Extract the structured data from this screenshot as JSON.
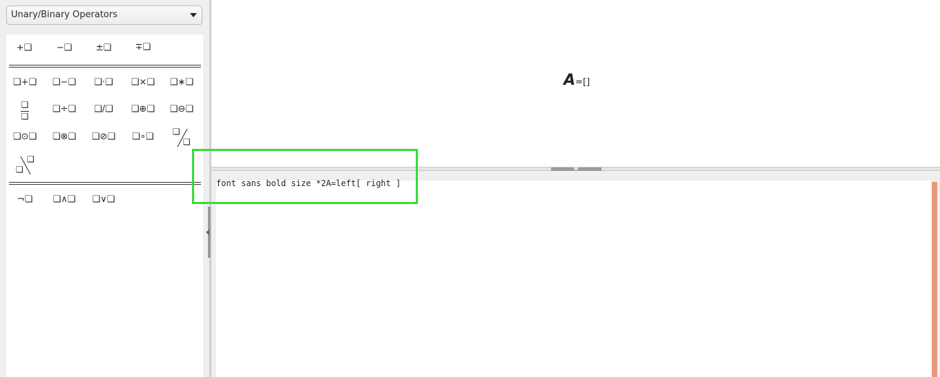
{
  "palette": {
    "category": "Unary/Binary Operators",
    "unary": [
      "+❑",
      "−❑",
      "±❑",
      "∓❑"
    ],
    "binary_row1": [
      "❑+❑",
      "❑−❑",
      "❑·❑",
      "❑×❑",
      "❑∗❑"
    ],
    "binary_row2_fraction": {
      "numerator": "❑",
      "denominator": "❑"
    },
    "binary_row2": [
      "❑÷❑",
      "❑/❑",
      "❑⊕❑",
      "❑⊖❑"
    ],
    "binary_row3": [
      "❑⊙❑",
      "❑⊗❑",
      "❑⊘❑",
      "❑∘❑"
    ],
    "slash_right": {
      "top": "❑",
      "bottom": "❑"
    },
    "slash_left": {
      "top": "❑",
      "bottom": "❑"
    },
    "logic": [
      "¬❑",
      "❑∧❑",
      "❑∨❑"
    ]
  },
  "preview": {
    "formula_main": "A",
    "formula_rest": "=[]"
  },
  "editor": {
    "text": "font sans bold size *2A=left[ right ]"
  },
  "colors": {
    "scrollbar": "#e59b7a",
    "focus_box": "#33dd33"
  }
}
